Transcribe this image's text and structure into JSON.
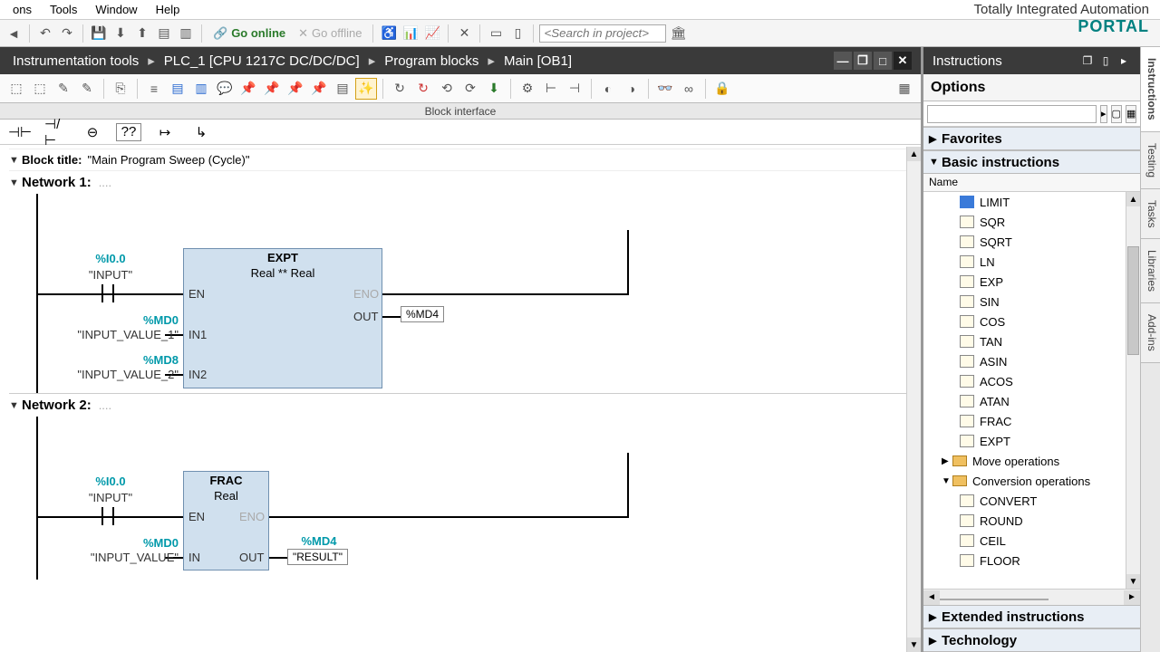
{
  "menu": {
    "items": [
      "ons",
      "Tools",
      "Window",
      "Help"
    ]
  },
  "brand": {
    "line1": "Totally Integrated Automation",
    "line2": "PORTAL"
  },
  "toolbar": {
    "go_online": "Go online",
    "go_offline": "Go offline",
    "search_placeholder": "<Search in project>"
  },
  "breadcrumb": {
    "parts": [
      "Instrumentation tools",
      "PLC_1 [CPU 1217C DC/DC/DC]",
      "Program blocks",
      "Main [OB1]"
    ]
  },
  "block_interface_label": "Block interface",
  "block_title_label": "Block title:",
  "block_title_value": "\"Main Program Sweep (Cycle)\"",
  "networks": [
    {
      "header": "Network 1:",
      "fb": {
        "name": "EXPT",
        "type": "Real  **  Real",
        "ports_left": [
          "EN",
          "IN1",
          "IN2"
        ],
        "ports_right": [
          "ENO",
          "OUT"
        ]
      },
      "contact": {
        "addr": "%I0.0",
        "name": "\"INPUT\""
      },
      "in1": {
        "addr": "%MD0",
        "name": "\"INPUT_VALUE_1\""
      },
      "in2": {
        "addr": "%MD8",
        "name": "\"INPUT_VALUE_2\""
      },
      "out": {
        "value": "%MD4"
      }
    },
    {
      "header": "Network 2:",
      "fb": {
        "name": "FRAC",
        "type": "Real",
        "ports_left": [
          "EN",
          "IN"
        ],
        "ports_right": [
          "ENO",
          "OUT"
        ]
      },
      "contact": {
        "addr": "%I0.0",
        "name": "\"INPUT\""
      },
      "in": {
        "addr": "%MD0",
        "name": "\"INPUT_VALUE\""
      },
      "out": {
        "addr": "%MD4",
        "name": "\"RESULT\""
      }
    }
  ],
  "right": {
    "title": "Instructions",
    "options": "Options",
    "name_col": "Name",
    "categories": {
      "favorites": "Favorites",
      "basic": "Basic instructions",
      "extended": "Extended instructions",
      "technology": "Technology"
    },
    "instructions": [
      "LIMIT",
      "SQR",
      "SQRT",
      "LN",
      "EXP",
      "SIN",
      "COS",
      "TAN",
      "ASIN",
      "ACOS",
      "ATAN",
      "FRAC",
      "EXPT"
    ],
    "folders": [
      {
        "name": "Move operations",
        "expanded": false
      },
      {
        "name": "Conversion operations",
        "expanded": true
      }
    ],
    "conv_instructions": [
      "CONVERT",
      "ROUND",
      "CEIL",
      "FLOOR"
    ]
  },
  "side_tabs": [
    "Instructions",
    "Testing",
    "Tasks",
    "Libraries",
    "Add-ins"
  ]
}
